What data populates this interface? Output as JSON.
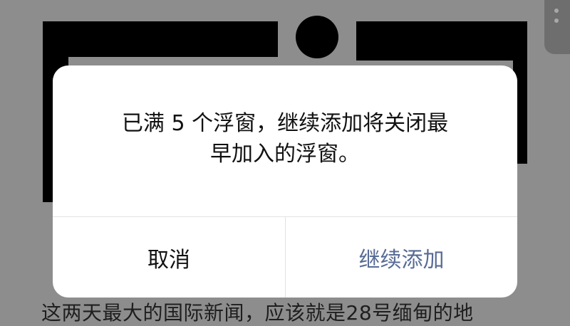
{
  "dialog": {
    "message_line1": "已满 5 个浮窗，继续添加将关闭最",
    "message_line2": "早加入的浮窗。",
    "cancel_label": "取消",
    "confirm_label": "继续添加"
  },
  "article": {
    "text": "这两天最大的国际新闻，应该就是28号缅甸的地"
  },
  "colors": {
    "confirm": "#576b95",
    "overlay": "#8d8d8d"
  }
}
